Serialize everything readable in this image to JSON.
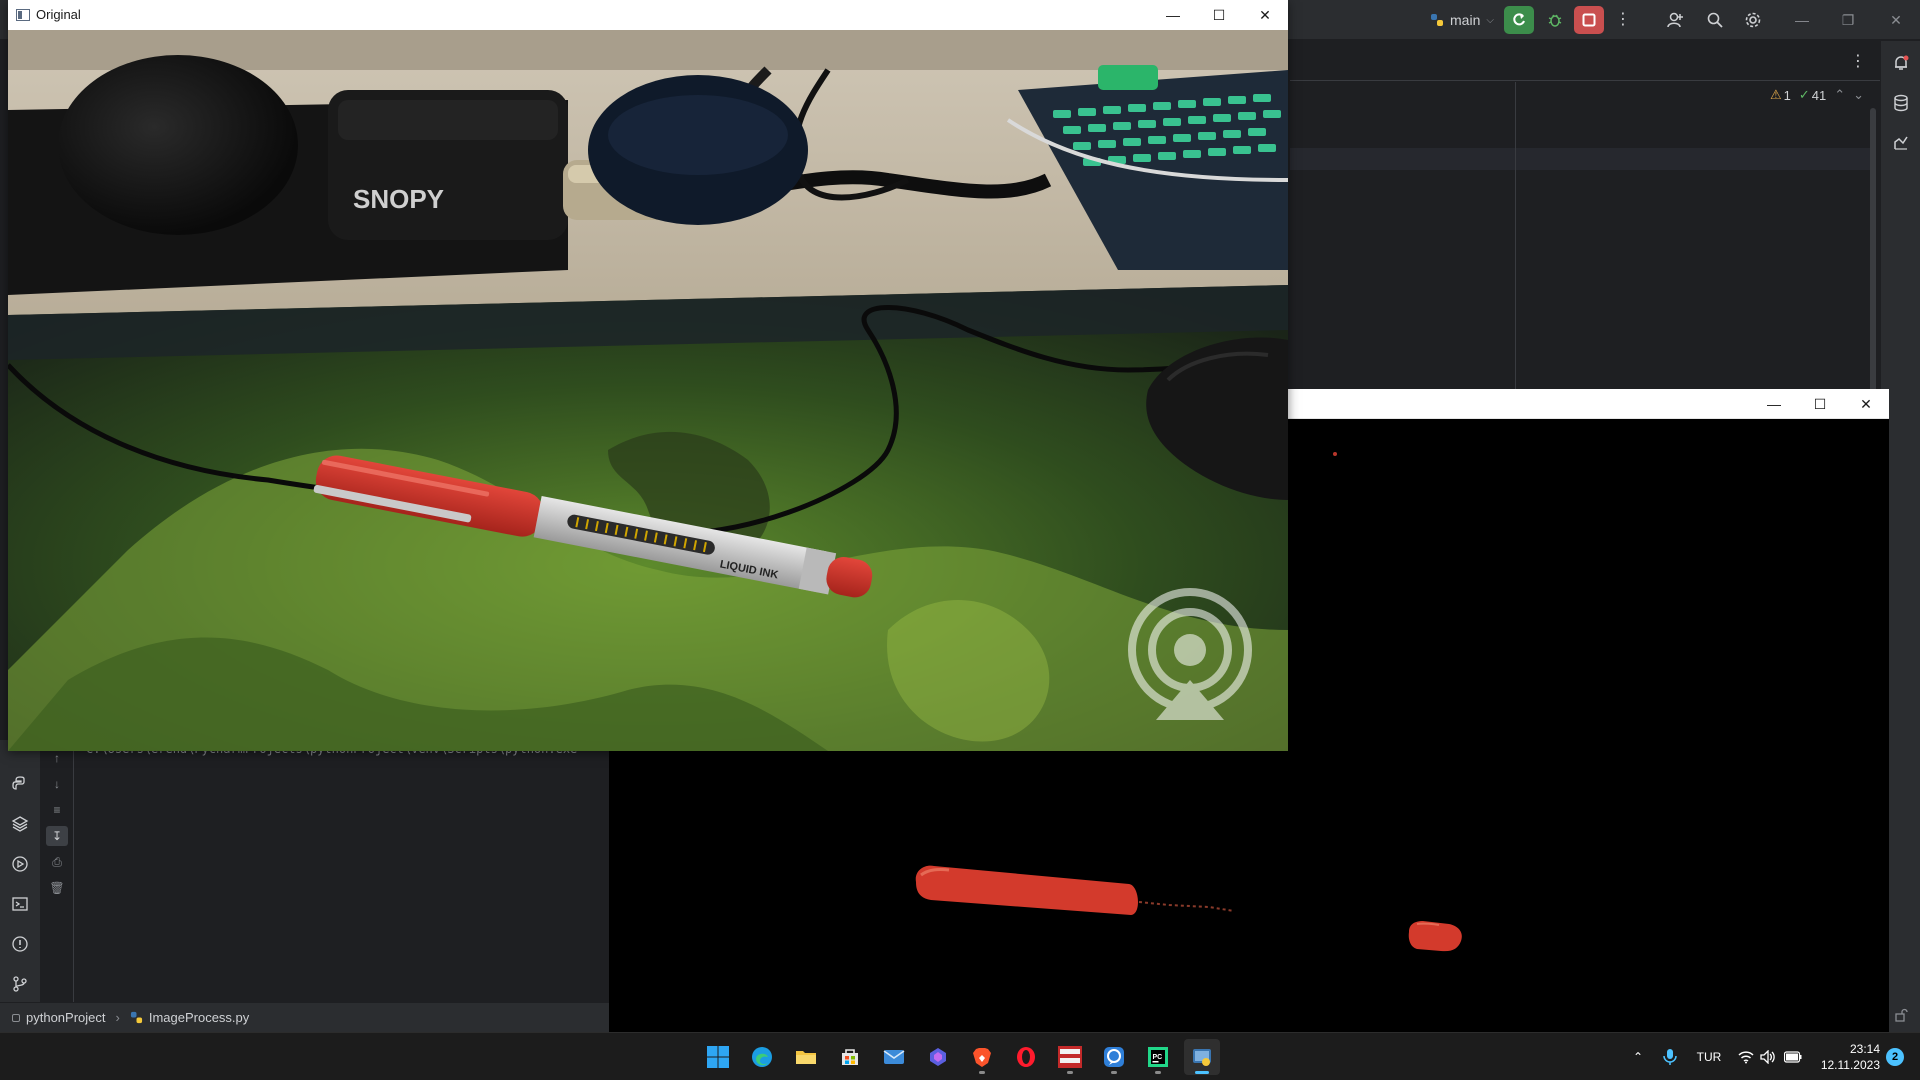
{
  "ide": {
    "run_config": "main",
    "inspections": {
      "warnings": "1",
      "checks": "41"
    },
    "console_line": "C:\\Users\\erend\\PycharmProjects\\pythonProject\\venv\\Scripts\\python.exe",
    "breadcrumb": {
      "project": "pythonProject",
      "file": "ImageProcess.py"
    }
  },
  "original_window": {
    "title": "Original",
    "photo_label": "SNOPY",
    "pen_text": "LIQUID INK"
  },
  "mask_window": {
    "title": ""
  },
  "taskbar": {
    "apps": [
      {
        "name": "Start",
        "icon": "windows-logo-icon",
        "running": false
      },
      {
        "name": "Microsoft Edge",
        "icon": "edge-icon",
        "running": false
      },
      {
        "name": "File Explorer",
        "icon": "folder-icon",
        "running": false
      },
      {
        "name": "Microsoft Store",
        "icon": "store-icon",
        "running": false
      },
      {
        "name": "Mail",
        "icon": "mail-icon",
        "running": false
      },
      {
        "name": "Copilot",
        "icon": "copilot-icon",
        "running": false
      },
      {
        "name": "Brave",
        "icon": "brave-icon",
        "running": true
      },
      {
        "name": "Opera",
        "icon": "opera-icon",
        "running": false
      },
      {
        "name": "Voicemeeter",
        "icon": "voicemeeter-icon",
        "running": true
      },
      {
        "name": "Messenger",
        "icon": "messenger-icon",
        "running": true
      },
      {
        "name": "PyCharm",
        "icon": "pycharm-icon",
        "running": true
      },
      {
        "name": "Python",
        "icon": "python-icon",
        "running": true,
        "active": true
      }
    ],
    "language": "TUR",
    "time": "23:14",
    "date": "12.11.2023",
    "notifications": "2"
  },
  "colors": {
    "ide_bg": "#1e1f22",
    "ide_panel": "#2b2d30",
    "run_green": "#3c8d4b",
    "stop_red": "#c94f4f",
    "pen_red": "#d6322b",
    "taskbar_bg": "#1c1c1c",
    "accent": "#4cc2ff"
  }
}
